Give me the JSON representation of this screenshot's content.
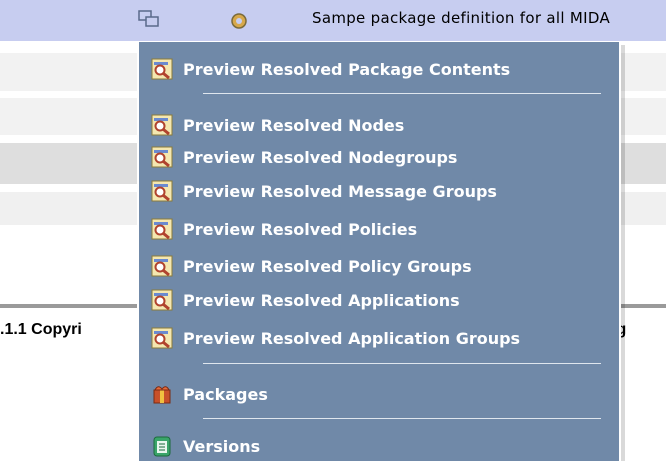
{
  "header": {
    "description": "Sampe package definition for all MIDA"
  },
  "footer": {
    "left_text": ".1.1 Copyri",
    "right_text": "ig"
  },
  "menu": {
    "items": [
      {
        "label": "Preview Resolved Package Contents",
        "icon": "preview-icon"
      },
      {
        "label": "Preview Resolved Nodes",
        "icon": "preview-icon"
      },
      {
        "label": "Preview Resolved Nodegroups",
        "icon": "preview-icon"
      },
      {
        "label": "Preview Resolved Message Groups",
        "icon": "preview-icon"
      },
      {
        "label": "Preview Resolved Policies",
        "icon": "preview-icon"
      },
      {
        "label": "Preview Resolved Policy Groups",
        "icon": "preview-icon"
      },
      {
        "label": "Preview Resolved Applications",
        "icon": "preview-icon"
      },
      {
        "label": "Preview Resolved Application Groups",
        "icon": "preview-icon"
      },
      {
        "label": "Packages",
        "icon": "package-icon"
      },
      {
        "label": "Versions",
        "icon": "versions-icon"
      }
    ]
  },
  "colors": {
    "header_row": "#c7cdf0",
    "menu_bg": "#7089a8",
    "menu_text": "#ffffff"
  }
}
